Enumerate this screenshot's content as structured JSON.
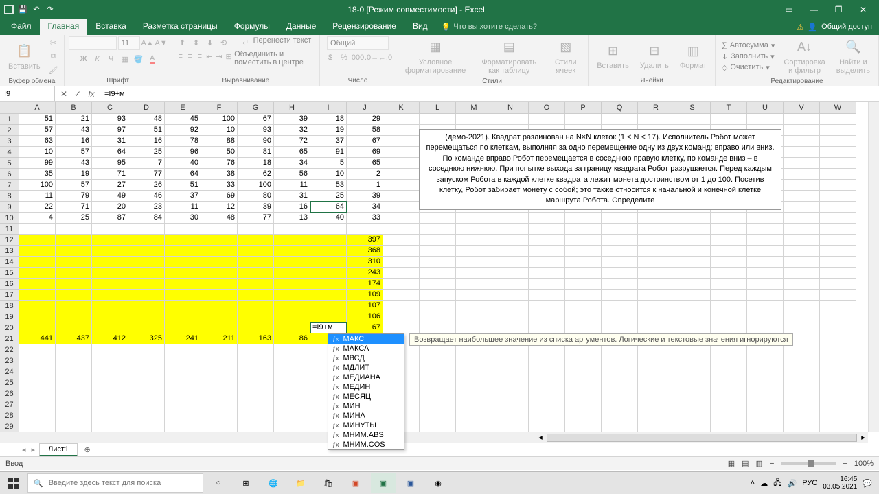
{
  "titlebar": {
    "title": "18-0 [Режим совместимости] - Excel"
  },
  "tabs": {
    "file": "Файл",
    "home": "Главная",
    "insert": "Вставка",
    "layout": "Разметка страницы",
    "formulas": "Формулы",
    "data": "Данные",
    "review": "Рецензирование",
    "view": "Вид",
    "tellme": "Что вы хотите сделать?",
    "share": "Общий доступ"
  },
  "ribbon": {
    "clipboard": {
      "label": "Буфер обмена",
      "paste": "Вставить"
    },
    "font": {
      "label": "Шрифт",
      "size": "11",
      "name": ""
    },
    "align": {
      "label": "Выравнивание",
      "wrap": "Перенести текст",
      "merge": "Объединить и поместить в центре"
    },
    "number": {
      "label": "Число",
      "format": "Общий"
    },
    "styles": {
      "label": "Стили",
      "cond": "Условное форматирование",
      "table": "Форматировать как таблицу",
      "cell": "Стили ячеек"
    },
    "cells": {
      "label": "Ячейки",
      "insert": "Вставить",
      "delete": "Удалить",
      "format": "Формат"
    },
    "editing": {
      "label": "Редактирование",
      "autosum": "Автосумма",
      "fill": "Заполнить",
      "clear": "Очистить",
      "sort": "Сортировка и фильтр",
      "find": "Найти и выделить"
    }
  },
  "formulabar": {
    "namebox": "I9",
    "formula": "=I9+м"
  },
  "columns": [
    "A",
    "B",
    "C",
    "D",
    "E",
    "F",
    "G",
    "H",
    "I",
    "J",
    "K",
    "L",
    "M",
    "N",
    "O",
    "P",
    "Q",
    "R",
    "S",
    "T",
    "U",
    "V",
    "W"
  ],
  "rows": {
    "1": [
      "51",
      "21",
      "93",
      "48",
      "45",
      "100",
      "67",
      "39",
      "18",
      "29"
    ],
    "2": [
      "57",
      "43",
      "97",
      "51",
      "92",
      "10",
      "93",
      "32",
      "19",
      "58"
    ],
    "3": [
      "63",
      "16",
      "31",
      "16",
      "78",
      "88",
      "90",
      "72",
      "37",
      "67"
    ],
    "4": [
      "10",
      "57",
      "64",
      "25",
      "96",
      "50",
      "81",
      "65",
      "91",
      "69"
    ],
    "5": [
      "99",
      "43",
      "95",
      "7",
      "40",
      "76",
      "18",
      "34",
      "5",
      "65"
    ],
    "6": [
      "35",
      "19",
      "71",
      "77",
      "64",
      "38",
      "62",
      "56",
      "10",
      "2"
    ],
    "7": [
      "100",
      "57",
      "27",
      "26",
      "51",
      "33",
      "100",
      "11",
      "53",
      "1"
    ],
    "8": [
      "11",
      "79",
      "49",
      "46",
      "37",
      "69",
      "80",
      "31",
      "25",
      "39"
    ],
    "9": [
      "22",
      "71",
      "20",
      "23",
      "11",
      "12",
      "39",
      "16",
      "64",
      "34"
    ],
    "10": [
      "4",
      "25",
      "87",
      "84",
      "30",
      "48",
      "77",
      "13",
      "40",
      "33"
    ]
  },
  "yellow_jcol": {
    "12": "397",
    "13": "368",
    "14": "310",
    "15": "243",
    "16": "174",
    "17": "109",
    "18": "107",
    "19": "106",
    "20": "67"
  },
  "editing_cell": {
    "row": 20,
    "col": 8,
    "text": "=I9+м"
  },
  "row21": [
    "441",
    "437",
    "412",
    "325",
    "241",
    "211",
    "163",
    "86"
  ],
  "taskbox": "(демо-2021). Квадрат разлинован на N×N клеток (1 < N < 17). Исполнитель Робот может перемещаться по клеткам, выполняя за одно перемещение одну из двух команд: вправо или вниз. По команде вправо Робот перемещается в соседнюю правую клетку, по команде вниз – в соседнюю нижнюю. При попытке выхода за границу квадрата Робот разрушается. Перед каждым запуском Робота в каждой клетке квадрата лежит монета достоинством от 1 до 100. Посетив клетку, Робот забирает монету с собой; это также относится к начальной и конечной клетке маршрута Робота. Определите",
  "autocomplete": {
    "items": [
      "МАКС",
      "МАКСА",
      "МВСД",
      "МДЛИТ",
      "МЕДИАНА",
      "МЕДИН",
      "МЕСЯЦ",
      "МИН",
      "МИНА",
      "МИНУТЫ",
      "МНИМ.ABS",
      "МНИМ.COS"
    ],
    "selected": 0,
    "tooltip": "Возвращает наибольшее значение из списка аргументов. Логические и текстовые значения игнорируются"
  },
  "sheet": {
    "tab1": "Лист1"
  },
  "statusbar": {
    "mode": "Ввод",
    "zoom": "100%"
  },
  "taskbar": {
    "search": "Введите здесь текст для поиска",
    "lang": "РУС",
    "time": "16:45",
    "date": "03.05.2021"
  }
}
